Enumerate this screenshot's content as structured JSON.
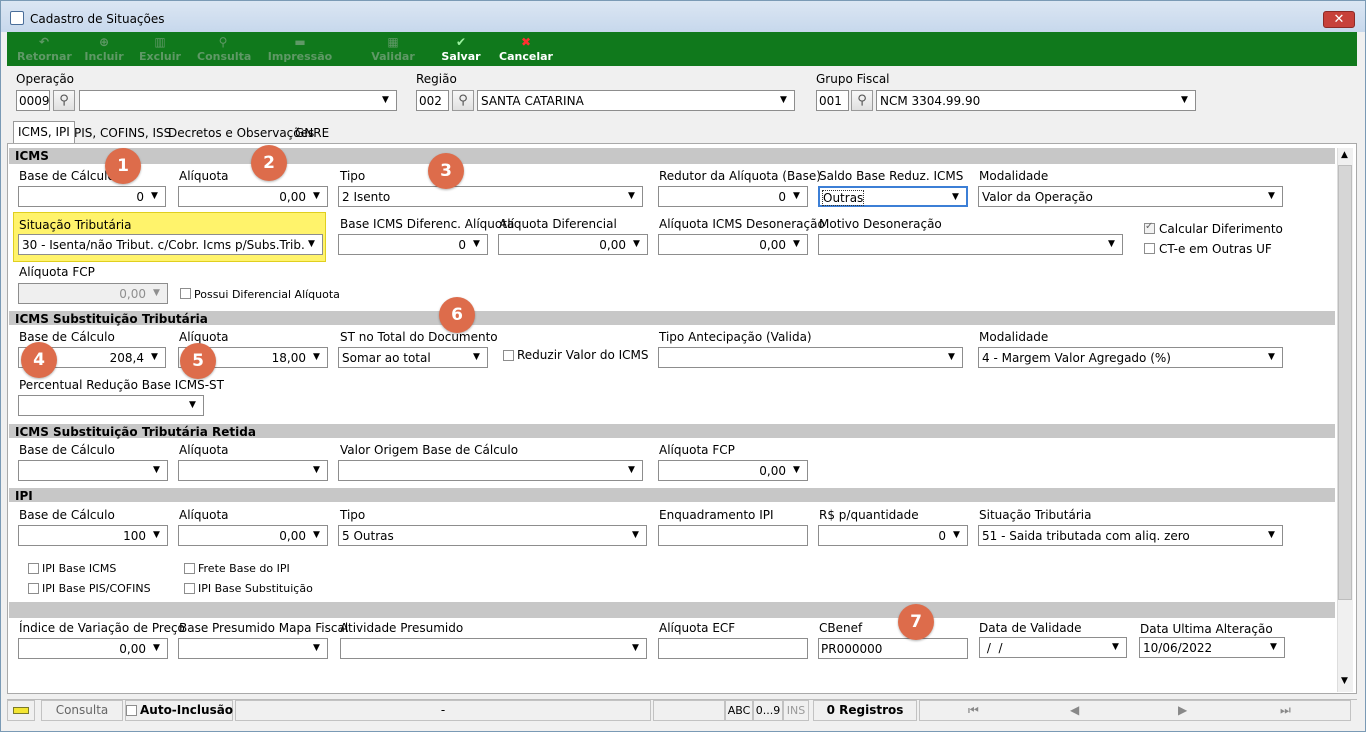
{
  "window": {
    "title": "Cadastro de Situações",
    "close": "✕"
  },
  "toolbar": {
    "retornar": "Retornar",
    "incluir": "Incluir",
    "excluir": "Excluir",
    "consulta": "Consulta",
    "impressao": "Impressão",
    "validar": "Validar",
    "salvar": "Salvar",
    "cancelar": "Cancelar"
  },
  "header": {
    "operacao": {
      "label": "Operação",
      "code": "0009",
      "value": ""
    },
    "regiao": {
      "label": "Região",
      "code": "002",
      "value": "SANTA CATARINA"
    },
    "grupo": {
      "label": "Grupo Fiscal",
      "code": "001",
      "value": "NCM 3304.99.90"
    }
  },
  "tabs": [
    "ICMS, IPI",
    "PIS, COFINS, ISS",
    "Decretos e Observações",
    "GNRE"
  ],
  "icms": {
    "title": "ICMS",
    "base_calculo": {
      "label": "Base de Cálculo",
      "value": "0"
    },
    "aliquota": {
      "label": "Alíquota",
      "value": "0,00"
    },
    "tipo": {
      "label": "Tipo",
      "value": "2 Isento"
    },
    "redutor": {
      "label": "Redutor da Alíquota (Base)",
      "value": "0"
    },
    "saldo": {
      "label": "Saldo Base Reduz. ICMS",
      "value": "Outras"
    },
    "modalidade": {
      "label": "Modalidade",
      "value": "Valor da Operação"
    },
    "situacao": {
      "label": "Situação Tributária",
      "value": "30 - Isenta/não Tribut. c/Cobr. Icms p/Subs.Trib."
    },
    "base_dif": {
      "label": "Base ICMS Diferenc. Alíquota",
      "value": "0"
    },
    "aliq_dif": {
      "label": "Alíquota Diferencial",
      "value": "0,00"
    },
    "aliq_deson": {
      "label": "Alíquota ICMS Desoneração",
      "value": "0,00"
    },
    "motivo": {
      "label": "Motivo Desoneração",
      "value": ""
    },
    "calc_dif": "Calcular Diferimento",
    "cte": "CT-e em Outras UF",
    "fcp": {
      "label": "Alíquota FCP",
      "value": "0,00"
    },
    "possui": "Possui Diferencial Alíquota"
  },
  "st": {
    "title": "ICMS Substituição Tributária",
    "base_calculo": {
      "label": "Base de Cálculo",
      "value": "208,4"
    },
    "aliquota": {
      "label": "Alíquota",
      "value": "18,00"
    },
    "no_total": {
      "label": "ST no Total do Documento",
      "value": "Somar ao total"
    },
    "reduzir": "Reduzir Valor do ICMS",
    "antecipacao": {
      "label": "Tipo Antecipação (Valida)",
      "value": ""
    },
    "modalidade": {
      "label": "Modalidade",
      "value": "4 - Margem Valor Agregado (%)"
    },
    "percentual": {
      "label": "Percentual Redução Base ICMS-ST",
      "value": ""
    }
  },
  "retida": {
    "title": "ICMS Substituição Tributária Retida",
    "base_calculo": {
      "label": "Base de Cálculo",
      "value": ""
    },
    "aliquota": {
      "label": "Alíquota",
      "value": ""
    },
    "valor_origem": {
      "label": "Valor Origem Base de Cálculo",
      "value": ""
    },
    "fcp": {
      "label": "Alíquota FCP",
      "value": "0,00"
    }
  },
  "ipi": {
    "title": "IPI",
    "base_calculo": {
      "label": "Base de Cálculo",
      "value": "100"
    },
    "aliquota": {
      "label": "Alíquota",
      "value": "0,00"
    },
    "tipo": {
      "label": "Tipo",
      "value": "5 Outras"
    },
    "enquadramento": {
      "label": "Enquadramento IPI",
      "value": ""
    },
    "rs_qtd": {
      "label": "R$ p/quantidade",
      "value": "0"
    },
    "situacao": {
      "label": "Situação Tributária",
      "value": "51 - Saida tributada com aliq. zero"
    },
    "base_icms": "IPI Base ICMS",
    "frete": "Frete Base do IPI",
    "base_pis": "IPI Base PIS/COFINS",
    "base_sub": "IPI Base Substituição"
  },
  "extra": {
    "indice": {
      "label": "Índice de Variação de Preço",
      "value": "0,00"
    },
    "presumido_mapa": {
      "label": "Base Presumido Mapa Fiscal",
      "value": ""
    },
    "atividade": {
      "label": "Atividade Presumido",
      "value": ""
    },
    "aliq_ecf": {
      "label": "Alíquota ECF",
      "value": ""
    },
    "cbenef": {
      "label": "CBenef",
      "value": "PR000000"
    },
    "validade": {
      "label": "Data de Validade",
      "value": " /  /"
    },
    "ultima": {
      "label": "Data Ultima Alteração",
      "value": "10/06/2022"
    }
  },
  "badges": [
    "1",
    "2",
    "3",
    "4",
    "5",
    "6",
    "7"
  ],
  "status": {
    "consulta": "Consulta",
    "auto": "Auto-Inclusão",
    "dash": "-",
    "abc": "ABC",
    "num": "0...9",
    "ins": "INS",
    "registros": "0 Registros"
  },
  "colors": {
    "toolbar": "#10791c",
    "badge": "#dd6c4b",
    "highlight": "#fff36b",
    "section": "#c7c7c7"
  }
}
